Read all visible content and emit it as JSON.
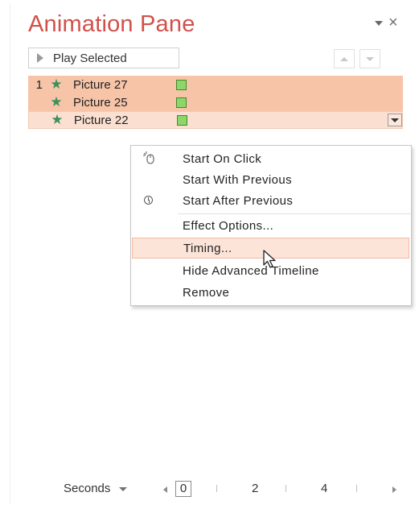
{
  "pane": {
    "title": "Animation Pane",
    "dropdown_icon": "chevron-down-icon",
    "close_icon": "close-icon",
    "close_glyph": "×"
  },
  "toolbar": {
    "play_label": "Play Selected",
    "play_icon": "play-icon",
    "move_up_icon": "move-up-icon",
    "move_down_icon": "move-down-icon"
  },
  "animations": [
    {
      "number": "1",
      "label": "Picture 27",
      "state": "selected"
    },
    {
      "number": "",
      "label": "Picture 25",
      "state": "selected"
    },
    {
      "number": "",
      "label": "Picture 22",
      "state": "focused"
    }
  ],
  "star_glyph": "★",
  "context_menu": {
    "items": [
      {
        "label": "Start On Click",
        "icon": "mouse-click-icon"
      },
      {
        "label": "Start With Previous",
        "icon": ""
      },
      {
        "label": "Start After Previous",
        "icon": "clock-icon"
      },
      {
        "label": "Effect Options...",
        "icon": ""
      },
      {
        "label": "Timing...",
        "icon": "",
        "hovered": true
      },
      {
        "label": "Hide Advanced Timeline",
        "icon": ""
      },
      {
        "label": "Remove",
        "icon": ""
      }
    ]
  },
  "footer": {
    "seconds_label": "Seconds",
    "scale_values": [
      "0",
      "2",
      "4"
    ]
  },
  "colors": {
    "title": "#d2504a",
    "selection": "#f7c4a8",
    "star": "#3e8f5c",
    "timeline_bar": "#8fd66a"
  }
}
